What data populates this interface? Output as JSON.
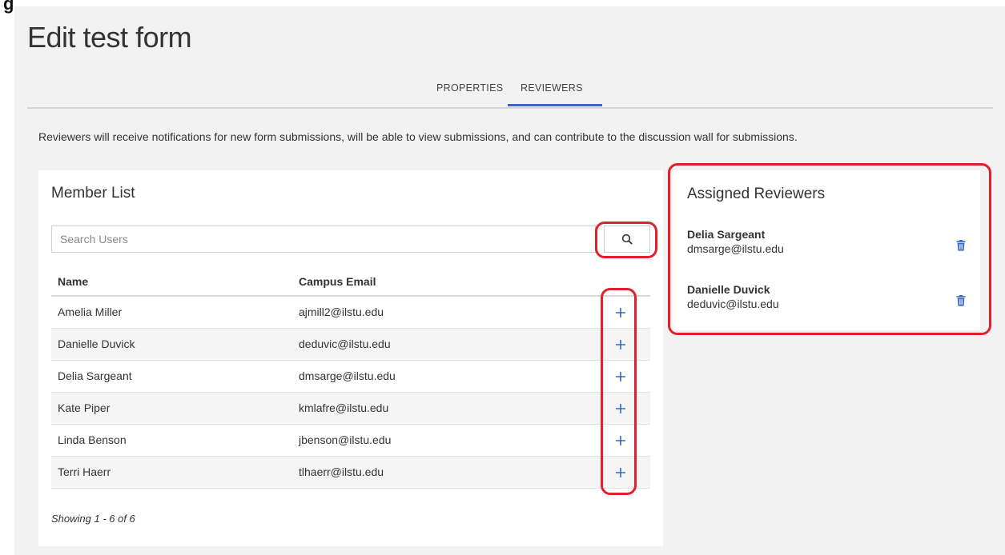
{
  "page": {
    "top_fragment": "g",
    "title": "Edit test form"
  },
  "tabs": [
    {
      "label": "PROPERTIES",
      "active": false
    },
    {
      "label": "REVIEWERS",
      "active": true
    }
  ],
  "description": "Reviewers will receive notifications for new form submissions, will be able to view submissions, and can contribute to the discussion wall for submissions.",
  "member_list": {
    "title": "Member List",
    "search_placeholder": "Search Users",
    "search_icon": "search-icon",
    "columns": [
      "Name",
      "Campus Email"
    ],
    "rows": [
      {
        "name": "Amelia Miller",
        "email": "ajmill2@ilstu.edu"
      },
      {
        "name": "Danielle Duvick",
        "email": "deduvic@ilstu.edu"
      },
      {
        "name": "Delia Sargeant",
        "email": "dmsarge@ilstu.edu"
      },
      {
        "name": "Kate Piper",
        "email": "kmlafre@ilstu.edu"
      },
      {
        "name": "Linda Benson",
        "email": "jbenson@ilstu.edu"
      },
      {
        "name": "Terri Haerr",
        "email": "tlhaerr@ilstu.edu"
      }
    ],
    "add_icon": "plus-icon",
    "showing": "Showing 1 - 6 of 6"
  },
  "assigned_reviewers": {
    "title": "Assigned Reviewers",
    "items": [
      {
        "name": "Delia Sargeant",
        "email": "dmsarge@ilstu.edu"
      },
      {
        "name": "Danielle Duvick",
        "email": "deduvic@ilstu.edu"
      }
    ],
    "remove_icon": "trash-icon"
  },
  "colors": {
    "accent": "#3a66c4",
    "highlight": "#e0202a",
    "background": "#f2f2f2",
    "panel": "#ffffff"
  }
}
